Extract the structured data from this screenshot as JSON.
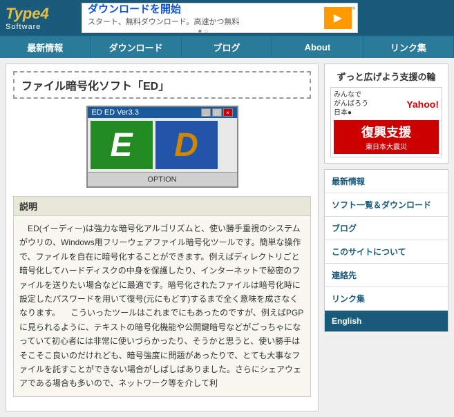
{
  "header": {
    "logo_type": "Type",
    "logo_num": "4",
    "logo_software": "Software",
    "ad": {
      "title": "ダウンロードを開始",
      "subtitle": "スタート、無料ダウンロード。高速かつ無料",
      "button_label": "▶",
      "close_label": "×"
    }
  },
  "nav": {
    "items": [
      {
        "label": "最新情報"
      },
      {
        "label": "ダウンロード"
      },
      {
        "label": "ブログ"
      },
      {
        "label": "About"
      },
      {
        "label": "リンク集"
      }
    ]
  },
  "page": {
    "title": "ファイル暗号化ソフト「ED」",
    "ed_window": {
      "title": "ED  ED Ver3.3",
      "option_label": "OPTION",
      "e_letter": "E",
      "d_letter": "D"
    },
    "description": {
      "section_title": "説明",
      "body": "　ED(イーディー)は強力な暗号化アルゴリズムと、使い勝手重視のシステムがウリの、Windows用フリーウェアファイル暗号化ツールです。簡単な操作で、ファイルを自在に暗号化することができます。例えばディレクトリごと暗号化してハードディスクの中身を保護したり、インターネットで秘密のファイルを送りたい場合などに最適です。暗号化されたファイルは暗号化時に設定したパスワードを用いて復号(元にもどす)するまで全く意味を成さなくなります。\n\n　こういったツールはこれまでにもあったのですが、例えばPGPに見られるように、テキストの暗号化機能や公開鍵暗号などがごっちゃになっていて初心者には非常に使いづらかったり、そうかと思うと、使い勝手はそこそこ良いのだけれども、暗号強度に問題があったりで、とても大事なファイルを託すことができない場合がしばしばありました。さらにシェアウェアである場合も多いので、ネットワーク等を介して利"
    }
  },
  "sidebar": {
    "support_title": "ずっと広げよう支援の輪",
    "yahoo_brand": "Yahoo!",
    "ganbare_line1": "みんなで",
    "ganbare_line2": "がんばろう",
    "ganbare_line3": "日本●",
    "fukko_main": "復興支援",
    "fukko_sub": "東日本大震災",
    "nav_items": [
      {
        "label": "最新情報"
      },
      {
        "label": "ソフト一覧＆ダウンロード"
      },
      {
        "label": "ブログ"
      },
      {
        "label": "このサイトについて"
      },
      {
        "label": "連絡先"
      },
      {
        "label": "リンク集"
      },
      {
        "label": "English",
        "class": "english"
      }
    ]
  }
}
